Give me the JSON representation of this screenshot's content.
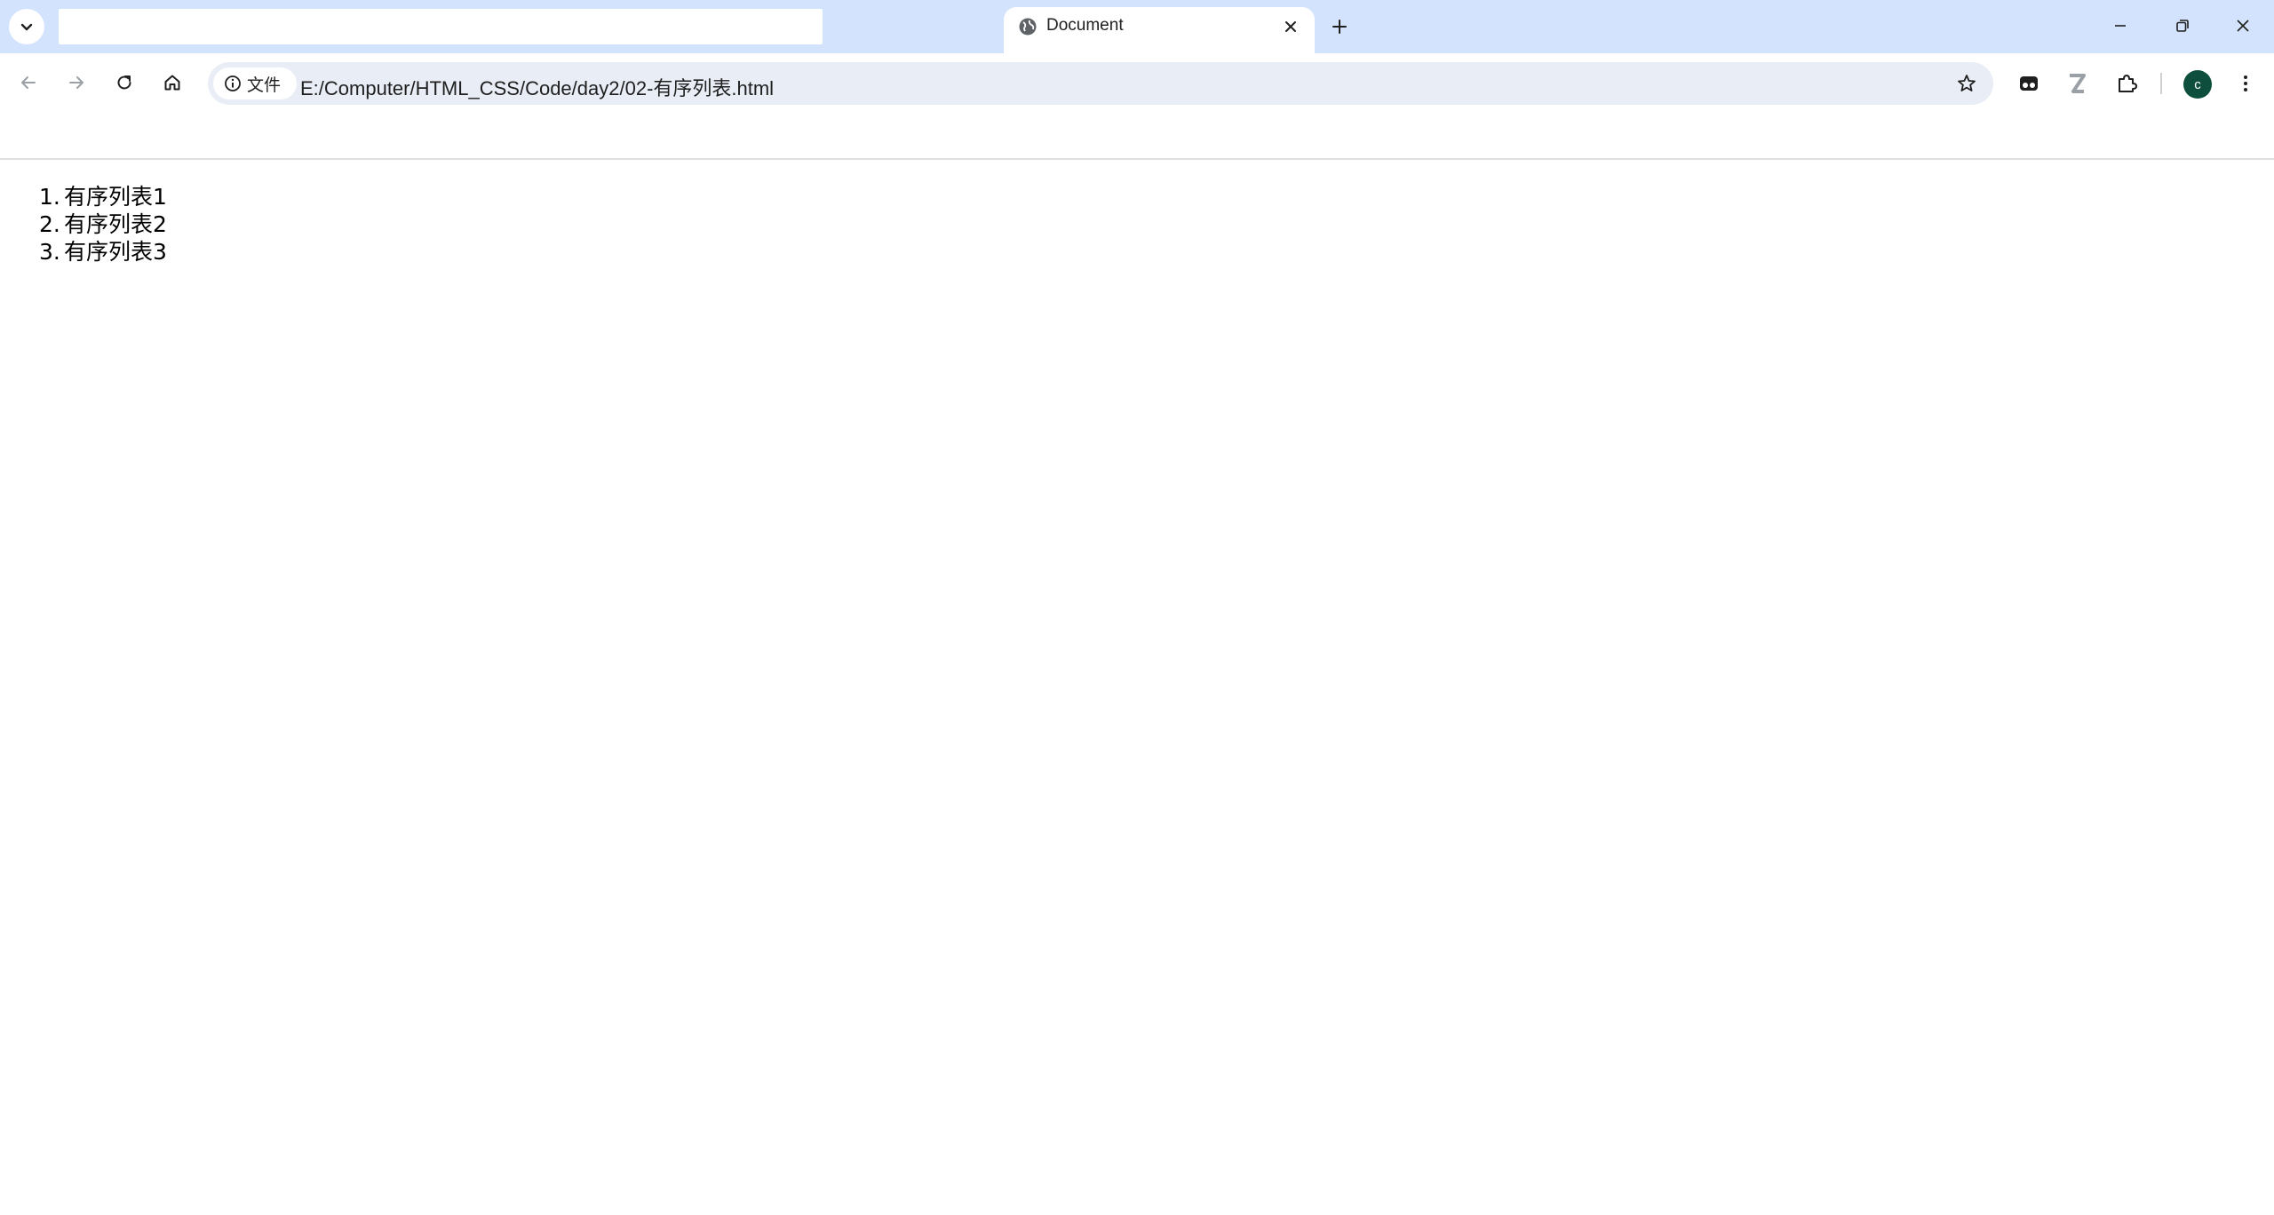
{
  "browser": {
    "tabs": [
      {
        "title": "",
        "active": false
      },
      {
        "title": "Document",
        "active": true
      }
    ],
    "address_bar": {
      "security_chip": "文件",
      "url": "E:/Computer/HTML_CSS/Code/day2/02-有序列表.html"
    },
    "profile_initial": "c"
  },
  "page": {
    "list_items": [
      {
        "number": "1.",
        "text": "有序列表1"
      },
      {
        "number": "2.",
        "text": "有序列表2"
      },
      {
        "number": "3.",
        "text": "有序列表3"
      }
    ]
  },
  "colors": {
    "tabstrip_bg": "#d3e3fd",
    "omnibox_bg": "#e9eef6",
    "avatar_bg": "#0d4f3c"
  }
}
